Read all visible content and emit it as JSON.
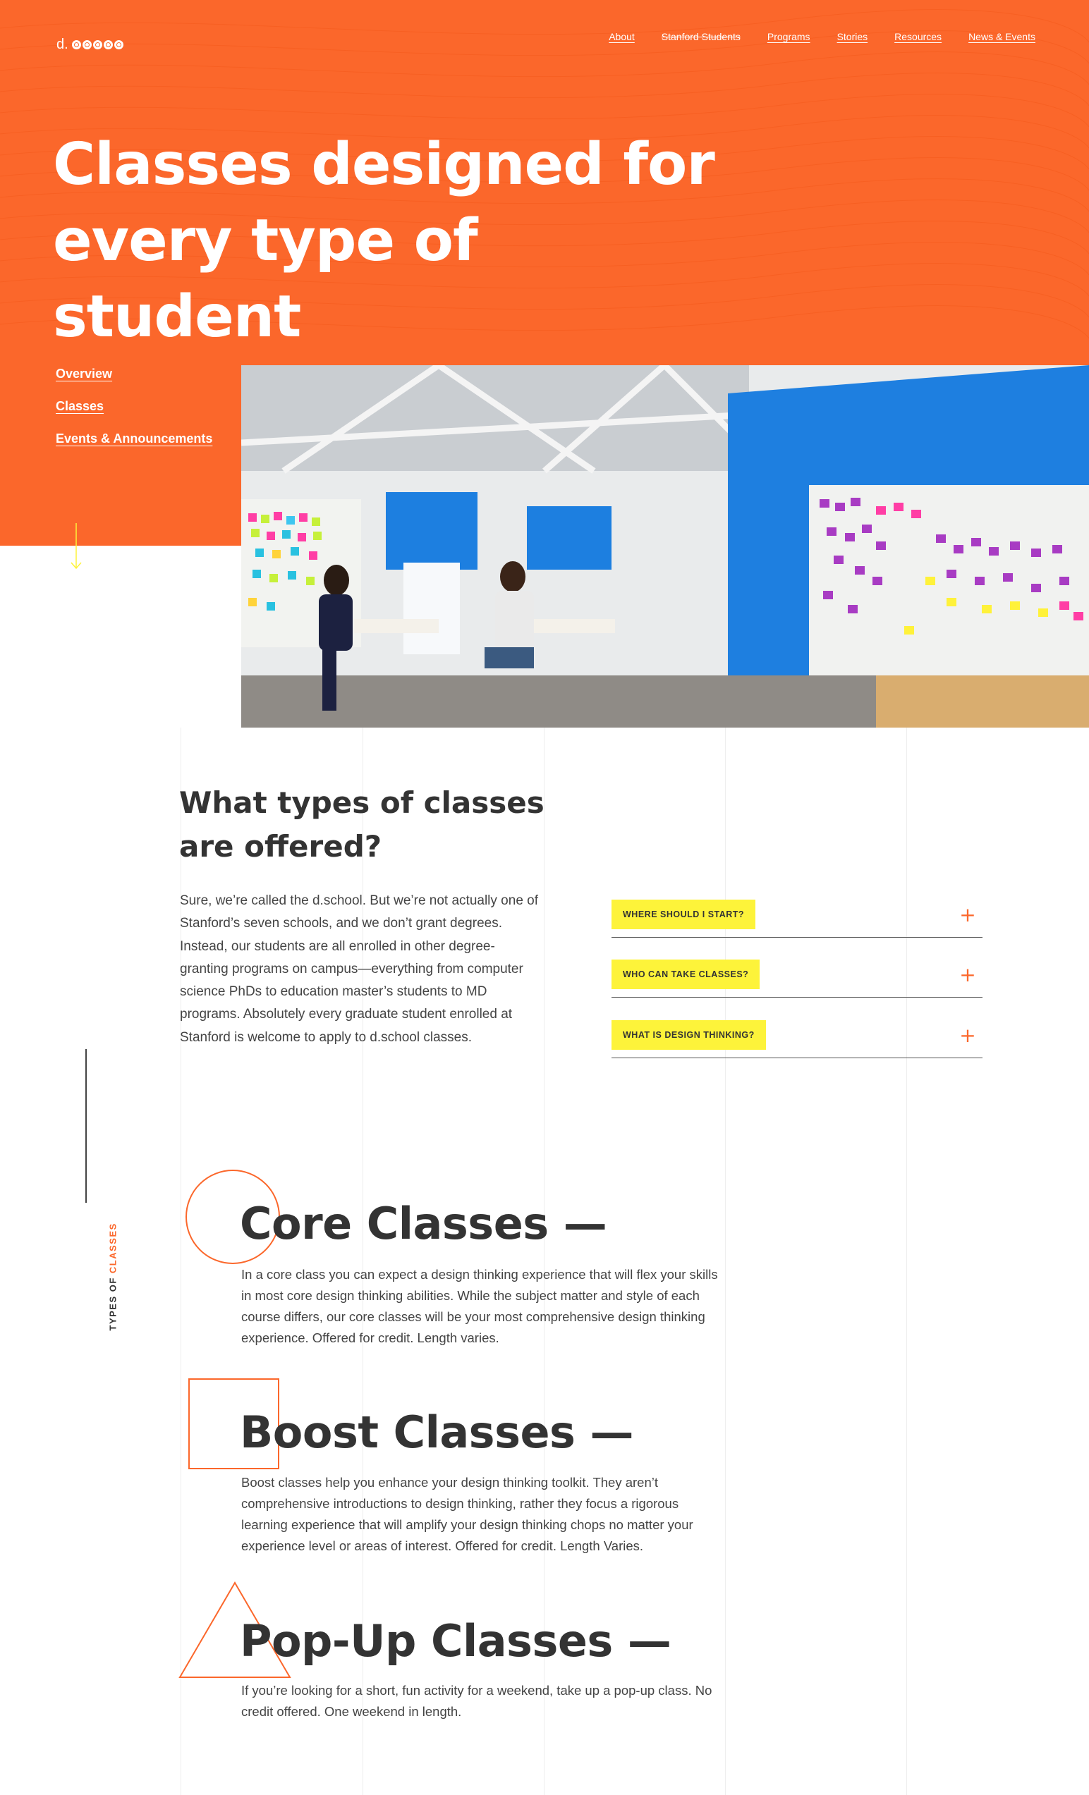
{
  "logo": {
    "text": "d."
  },
  "nav": {
    "items": [
      {
        "label": "About",
        "strike": false
      },
      {
        "label": "Stanford Students",
        "strike": true
      },
      {
        "label": "Programs",
        "strike": false
      },
      {
        "label": "Stories",
        "strike": false
      },
      {
        "label": "Resources",
        "strike": false
      },
      {
        "label": "News & Events",
        "strike": false
      }
    ]
  },
  "hero": {
    "title_line1": "Classes designed for",
    "title_line2": "every type of student"
  },
  "subnav": {
    "overview": "Overview",
    "classes": "Classes",
    "events": "Events & Announcements"
  },
  "intro": {
    "title_line1": "What types of classes",
    "title_line2": "are offered?",
    "body": "Sure, we’re called the d.school. But we’re not actually one of Stanford’s seven schools, and we don’t grant degrees. Instead, our students are all enrolled in other degree-granting programs on campus—everything from computer science PhDs to education master’s students to MD programs. Absolutely every graduate student enrolled at Stanford is welcome to apply to d.school classes."
  },
  "faq": [
    {
      "question": "Where should I start?",
      "icon": "plus-icon"
    },
    {
      "question": "Who can take classes?",
      "icon": "plus-icon"
    },
    {
      "question": "What is design thinking?",
      "icon": "plus-icon"
    }
  ],
  "side_label": {
    "part1": "TYPES OF ",
    "part2": "CLASSES"
  },
  "class_types": [
    {
      "title": "Core Classes —",
      "shape": "circle",
      "body": "In a core class you can expect a design thinking experience that will flex your skills in most core design thinking abilities. While the subject matter and style of each course differs, our core classes will be your most comprehensive design thinking experience. Offered for credit. Length varies."
    },
    {
      "title": "Boost Classes —",
      "shape": "square",
      "body": "Boost classes help you enhance your design thinking toolkit. They aren’t comprehensive introductions to design thinking, rather they focus a rigorous learning experience that will amplify your design thinking chops no matter your experience level or areas of interest. Offered for credit. Length Varies."
    },
    {
      "title": "Pop-Up Classes —",
      "shape": "triangle",
      "body": "If you’re looking for a short, fun activity for a weekend, take up a pop-up class. No credit offered. One weekend in length."
    }
  ],
  "colors": {
    "brand_orange": "#fb672b",
    "highlight_yellow": "#fdf33a",
    "text_dark": "#333333",
    "accent_blue": "#1e7fe0"
  }
}
